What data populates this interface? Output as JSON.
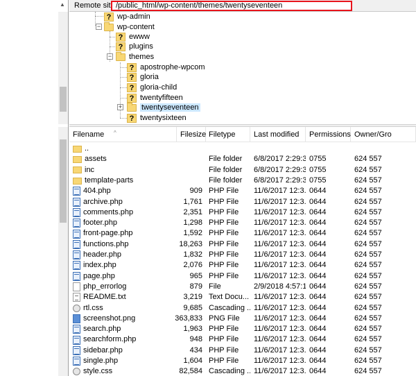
{
  "remote": {
    "label": "Remote site:",
    "path": "/public_html/wp-content/themes/twentyseventeen"
  },
  "tree": [
    {
      "label": "wp-admin",
      "icon": "question-folder-icon"
    },
    {
      "label": "wp-content",
      "icon": "folder-icon"
    },
    {
      "label": "ewww",
      "icon": "question-folder-icon"
    },
    {
      "label": "plugins",
      "icon": "question-folder-icon"
    },
    {
      "label": "themes",
      "icon": "folder-icon"
    },
    {
      "label": "apostrophe-wpcom",
      "icon": "question-folder-icon"
    },
    {
      "label": "gloria",
      "icon": "question-folder-icon"
    },
    {
      "label": "gloria-child",
      "icon": "question-folder-icon"
    },
    {
      "label": "twentyfifteen",
      "icon": "question-folder-icon"
    },
    {
      "label": "twentyseventeen",
      "icon": "folder-icon",
      "selected": true
    },
    {
      "label": "twentysixteen",
      "icon": "question-folder-icon"
    }
  ],
  "columns": {
    "filename": "Filename",
    "filesize": "Filesize",
    "filetype": "Filetype",
    "modified": "Last modified",
    "permissions": "Permissions",
    "owner": "Owner/Gro"
  },
  "files": [
    {
      "name": "..",
      "size": "",
      "type": "",
      "modified": "",
      "perm": "",
      "owner": "",
      "icon": "folder"
    },
    {
      "name": "assets",
      "size": "",
      "type": "File folder",
      "modified": "6/8/2017 2:29:3...",
      "perm": "0755",
      "owner": "624 557",
      "icon": "folder"
    },
    {
      "name": "inc",
      "size": "",
      "type": "File folder",
      "modified": "6/8/2017 2:29:3...",
      "perm": "0755",
      "owner": "624 557",
      "icon": "folder"
    },
    {
      "name": "template-parts",
      "size": "",
      "type": "File folder",
      "modified": "6/8/2017 2:29:3...",
      "perm": "0755",
      "owner": "624 557",
      "icon": "folder"
    },
    {
      "name": "404.php",
      "size": "909",
      "type": "PHP File",
      "modified": "11/6/2017 12:3...",
      "perm": "0644",
      "owner": "624 557",
      "icon": "php"
    },
    {
      "name": "archive.php",
      "size": "1,761",
      "type": "PHP File",
      "modified": "11/6/2017 12:3...",
      "perm": "0644",
      "owner": "624 557",
      "icon": "php"
    },
    {
      "name": "comments.php",
      "size": "2,351",
      "type": "PHP File",
      "modified": "11/6/2017 12:3...",
      "perm": "0644",
      "owner": "624 557",
      "icon": "php"
    },
    {
      "name": "footer.php",
      "size": "1,298",
      "type": "PHP File",
      "modified": "11/6/2017 12:3...",
      "perm": "0644",
      "owner": "624 557",
      "icon": "php"
    },
    {
      "name": "front-page.php",
      "size": "1,592",
      "type": "PHP File",
      "modified": "11/6/2017 12:3...",
      "perm": "0644",
      "owner": "624 557",
      "icon": "php"
    },
    {
      "name": "functions.php",
      "size": "18,263",
      "type": "PHP File",
      "modified": "11/6/2017 12:3...",
      "perm": "0644",
      "owner": "624 557",
      "icon": "php"
    },
    {
      "name": "header.php",
      "size": "1,832",
      "type": "PHP File",
      "modified": "11/6/2017 12:3...",
      "perm": "0644",
      "owner": "624 557",
      "icon": "php"
    },
    {
      "name": "index.php",
      "size": "2,076",
      "type": "PHP File",
      "modified": "11/6/2017 12:3...",
      "perm": "0644",
      "owner": "624 557",
      "icon": "php"
    },
    {
      "name": "page.php",
      "size": "965",
      "type": "PHP File",
      "modified": "11/6/2017 12:3...",
      "perm": "0644",
      "owner": "624 557",
      "icon": "php"
    },
    {
      "name": "php_errorlog",
      "size": "879",
      "type": "File",
      "modified": "2/9/2018 4:57:1...",
      "perm": "0644",
      "owner": "624 557",
      "icon": "doc"
    },
    {
      "name": "README.txt",
      "size": "3,219",
      "type": "Text Docu...",
      "modified": "11/6/2017 12:3...",
      "perm": "0644",
      "owner": "624 557",
      "icon": "txt"
    },
    {
      "name": "rtl.css",
      "size": "9,685",
      "type": "Cascading ...",
      "modified": "11/6/2017 12:3...",
      "perm": "0644",
      "owner": "624 557",
      "icon": "css"
    },
    {
      "name": "screenshot.png",
      "size": "363,833",
      "type": "PNG File",
      "modified": "11/6/2017 12:3...",
      "perm": "0644",
      "owner": "624 557",
      "icon": "png"
    },
    {
      "name": "search.php",
      "size": "1,963",
      "type": "PHP File",
      "modified": "11/6/2017 12:3...",
      "perm": "0644",
      "owner": "624 557",
      "icon": "php"
    },
    {
      "name": "searchform.php",
      "size": "948",
      "type": "PHP File",
      "modified": "11/6/2017 12:3...",
      "perm": "0644",
      "owner": "624 557",
      "icon": "php"
    },
    {
      "name": "sidebar.php",
      "size": "434",
      "type": "PHP File",
      "modified": "11/6/2017 12:3...",
      "perm": "0644",
      "owner": "624 557",
      "icon": "php"
    },
    {
      "name": "single.php",
      "size": "1,604",
      "type": "PHP File",
      "modified": "11/6/2017 12:3...",
      "perm": "0644",
      "owner": "624 557",
      "icon": "php"
    },
    {
      "name": "style.css",
      "size": "82,584",
      "type": "Cascading ...",
      "modified": "11/6/2017 12:3...",
      "perm": "0644",
      "owner": "624 557",
      "icon": "css"
    }
  ],
  "colors": {
    "highlight_border": "#e8141c",
    "selection": "#cce8ff",
    "folder": "#f8d775"
  }
}
